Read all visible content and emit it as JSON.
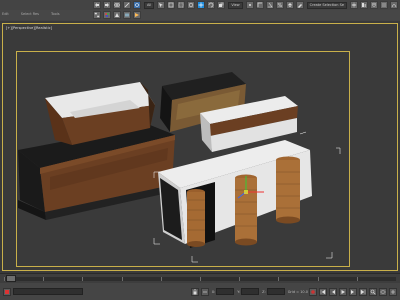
{
  "menu": {
    "items": [
      "Edit",
      "Select Res",
      "Tools"
    ]
  },
  "toolbar": {
    "selection_filter": "All",
    "view_dropdown": "View",
    "selection_set": "Create Selection Se"
  },
  "viewport": {
    "label": "[+][Perspective][Realistic]"
  },
  "timeline": {
    "frames": [
      "0",
      "10",
      "20",
      "30",
      "40",
      "50",
      "60",
      "70",
      "80",
      "90",
      "100"
    ]
  },
  "statusbar": {
    "x_label": "X:",
    "y_label": "Y:",
    "z_label": "Z:",
    "grid_text": "Grid = 10.0",
    "auto_key": "Add Time Tag"
  },
  "colors": {
    "wood": "#6b3f22",
    "white_panel": "#e6e6e6",
    "frame": "#c9b04a",
    "viewport_bg": "#3a3a3a"
  }
}
